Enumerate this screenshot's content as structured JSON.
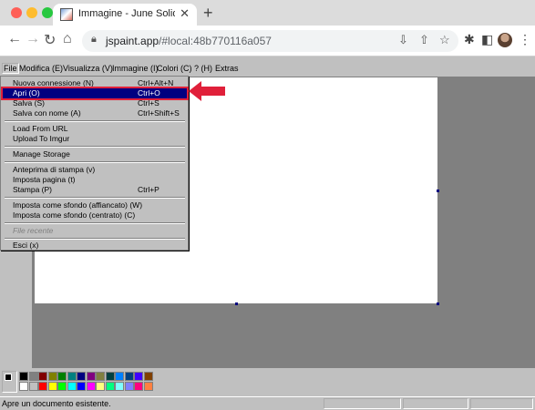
{
  "browser": {
    "tab_title": "Immagine - June Solidarity Pai",
    "url_main": "jspaint.app",
    "url_rest": "/#local:48b770116a057"
  },
  "menubar": {
    "items": [
      "File",
      "Modifica (E)",
      "Visualizza (V)",
      "Immagine (I)",
      "Colori (C)",
      "? (H)",
      "Extras"
    ]
  },
  "file_menu": {
    "items": [
      {
        "label": "Nuova connessione (N)",
        "shortcut": "Ctrl+Alt+N"
      },
      {
        "label": "Apri (O)",
        "shortcut": "Ctrl+O"
      },
      {
        "label": "Salva (S)",
        "shortcut": "Ctrl+S"
      },
      {
        "label": "Salva con nome (A)",
        "shortcut": "Ctrl+Shift+S"
      },
      {
        "label": "Load From URL",
        "shortcut": ""
      },
      {
        "label": "Upload To Imgur",
        "shortcut": ""
      },
      {
        "label": "Manage Storage",
        "shortcut": ""
      },
      {
        "label": "Anteprima di stampa (v)",
        "shortcut": ""
      },
      {
        "label": "Imposta pagina (t)",
        "shortcut": ""
      },
      {
        "label": "Stampa (P)",
        "shortcut": "Ctrl+P"
      },
      {
        "label": "Imposta come sfondo (affiancato) (W)",
        "shortcut": ""
      },
      {
        "label": "Imposta come sfondo (centrato) (C)",
        "shortcut": ""
      },
      {
        "label": "File recente",
        "shortcut": ""
      },
      {
        "label": "Esci (x)",
        "shortcut": ""
      }
    ],
    "highlighted_index": 1
  },
  "status": {
    "text": "Apre un documento esistente."
  },
  "palette": {
    "top_row": [
      "#000000",
      "#808080",
      "#800000",
      "#808000",
      "#008000",
      "#008080",
      "#000080",
      "#800080",
      "#808040",
      "#004040",
      "#0080ff",
      "#004080",
      "#4000ff",
      "#804000"
    ],
    "bottom_row": [
      "#ffffff",
      "#c0c0c0",
      "#ff0000",
      "#ffff00",
      "#00ff00",
      "#00ffff",
      "#0000ff",
      "#ff00ff",
      "#ffff80",
      "#00ff80",
      "#80ffff",
      "#8080ff",
      "#ff0080",
      "#ff8040"
    ]
  },
  "colors": {
    "highlight": "#000080",
    "annotation": "#e0203a"
  }
}
